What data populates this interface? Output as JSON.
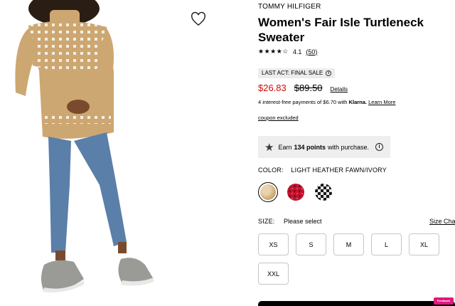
{
  "product": {
    "brand": "TOMMY HILFIGER",
    "title": "Women's Fair Isle Turtleneck Sweater",
    "image_alt": "Model wearing fair isle turtleneck sweater with jeans and grey sneakers"
  },
  "rating": {
    "stars_display": "★★★★☆",
    "value": "4.1",
    "count": "(50)"
  },
  "badges": {
    "final_sale": "LAST ACT: FINAL SALE",
    "info_glyph": "i"
  },
  "pricing": {
    "sale_price": "$26.83",
    "original_price": "$89.50",
    "details_link": "Details"
  },
  "financing": {
    "text": "4 interest-free payments of $6.70 with",
    "brand": "Klarna.",
    "learn_more": "Learn More"
  },
  "coupon": {
    "text": "coupon excluded"
  },
  "points": {
    "prefix": "Earn",
    "amount": "134 points",
    "suffix": "with purchase."
  },
  "color": {
    "label": "COLOR:",
    "selected": "LIGHT HEATHER FAWN/IVORY",
    "swatches": [
      "light-heather-fawn",
      "red-pattern",
      "black-pattern"
    ]
  },
  "size": {
    "label": "SIZE:",
    "prompt": "Please select",
    "chart_link": "Size Chart",
    "options": [
      "XS",
      "S",
      "M",
      "L",
      "XL",
      "XXL"
    ]
  },
  "feedback_tab": "Feedback",
  "colors": {
    "sale_red": "#d10a0a",
    "klarna_pink": "#e0187d",
    "sweater_tan": "#cda771",
    "denim": "#5a7fa9"
  }
}
